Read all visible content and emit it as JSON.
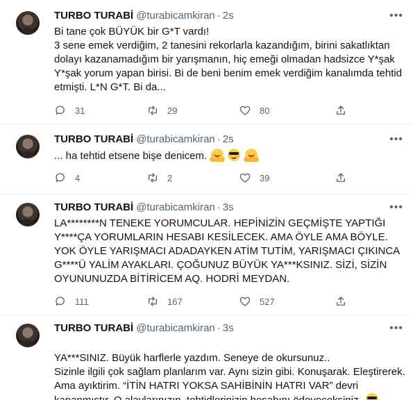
{
  "tweets": [
    {
      "name": "TURBO TURABİ",
      "handle": "@turabicamkiran",
      "dot": "·",
      "time": "2s",
      "text": "Bi tane çok BÜYÜK bir G*T vardı!\n3 sene emek verdiğim, 2 tanesini rekorlarla kazandığım, birini sakatlıktan dolayı kazanamadığım bir yarışmanın, hiç emeği olmadan hadsizce Y*şak Y*şak yorum yapan birisi. Bi de beni benim emek verdiğim kanalımda tehtid etmişti. L*N G*T. Bi da...",
      "replies": "31",
      "retweets": "29",
      "likes": "80"
    },
    {
      "name": "TURBO TURABİ",
      "handle": "@turabicamkiran",
      "dot": "·",
      "time": "2s",
      "text": "... ha tehtid etsene bişe denicem.",
      "replies": "4",
      "retweets": "2",
      "likes": "39"
    },
    {
      "name": "TURBO TURABİ",
      "handle": "@turabicamkiran",
      "dot": "·",
      "time": "3s",
      "text": "LA********N TENEKE YORUMCULAR.  HEPİNİZİN GEÇMİŞTE YAPTIĞI Y****ÇA YORUMLARIN HESABI KESİLECEK. AMA ÖYLE AMA BÖYLE. YOK ÖYLE YARIŞMACI ADADAYKEN ATİM TUTİM, YARIŞMACI ÇIKINCA G****Ü  YALİM AYAKLARI. ÇOĞUNUZ BÜYÜK YA***KSINIZ. SİZİ, SİZİN OYUNUNUZDA BİTİRİCEM AQ. HODRİ MEYDAN.",
      "replies": "111",
      "retweets": "167",
      "likes": "527"
    },
    {
      "name": "TURBO TURABİ",
      "handle": "@turabicamkiran",
      "dot": "·",
      "time": "3s",
      "text": "YA***SINIZ. Büyük harflerle yazdım. Seneye de okursunuz..\nSizinle ilgili çok sağlam planlarım var. Aynı sizin gibi. Konuşarak. Eleştirerek. Ama ayıktirim. “İTİN HATRI YOKSA SAHİBİNİN HATRI VAR” devri kapanmıştır. O alaylarınızın, tehtidlerinizin hesabını ödeyeceksiniz."
    }
  ],
  "icons": {
    "reply": "reply-icon",
    "retweet": "retweet-icon",
    "like": "heart-icon",
    "share": "share-icon",
    "more": "more-icon"
  },
  "colors": {
    "text": "#0f1419",
    "secondary": "#536471",
    "divider": "#eff3f4"
  }
}
